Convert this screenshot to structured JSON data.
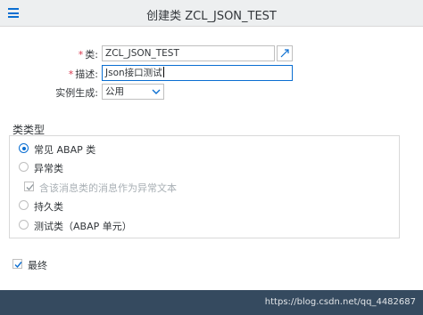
{
  "header": {
    "title": "创建类 ZCL_JSON_TEST"
  },
  "form": {
    "class_label": "类:",
    "class_value": "ZCL_JSON_TEST",
    "description_label": "描述:",
    "description_value": "Json接口测试",
    "instantiation_label": "实例生成:",
    "instantiation_value": "公用"
  },
  "class_type": {
    "title": "类类型",
    "options": [
      {
        "label": "常见 ABAP 类",
        "selected": true
      },
      {
        "label": "异常类",
        "selected": false
      },
      {
        "label": "含该消息类的消息作为异常文本",
        "checked": true,
        "disabled": true
      },
      {
        "label": "持久类",
        "selected": false
      },
      {
        "label": "测试类（ABAP 单元）",
        "selected": false
      }
    ]
  },
  "final": {
    "label": "最终",
    "checked": true
  },
  "footer": {
    "watermark": "https://blog.csdn.net/qq_4482687"
  },
  "colors": {
    "accent": "#0a6ed1",
    "required": "#d9364c",
    "footer_bg": "#354a5f"
  }
}
